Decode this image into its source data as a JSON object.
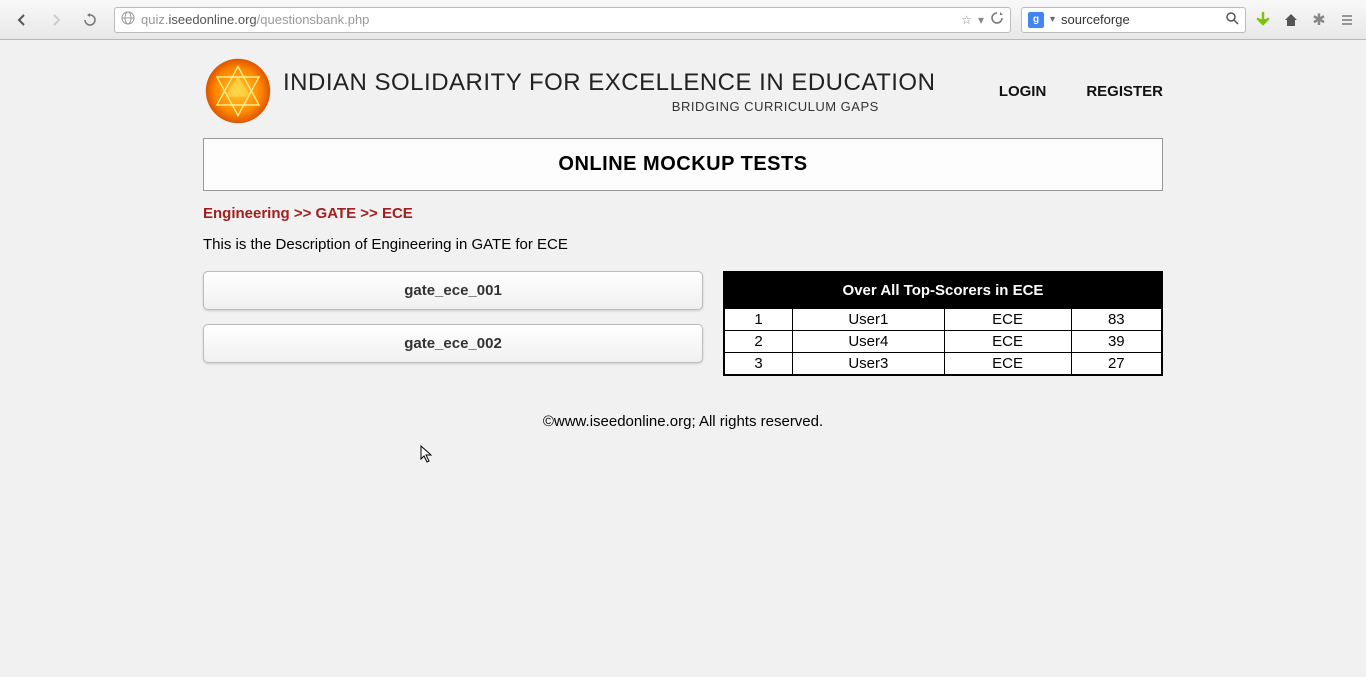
{
  "browser": {
    "url_prefix": "quiz.",
    "url_domain": "iseedonline.org",
    "url_path": "/questionsbank.php",
    "search_value": "sourceforge"
  },
  "header": {
    "title": "INDIAN SOLIDARITY FOR EXCELLENCE IN EDUCATION",
    "subtitle": "BRIDGING CURRICULUM GAPS",
    "login": "LOGIN",
    "register": "REGISTER"
  },
  "banner": "ONLINE MOCKUP TESTS",
  "breadcrumb": "Engineering >> GATE >> ECE",
  "description": "This is the Description of Engineering in GATE for ECE",
  "tests": [
    "gate_ece_001",
    "gate_ece_002"
  ],
  "scores": {
    "title": "Over All Top-Scorers in ECE",
    "rows": [
      {
        "rank": "1",
        "user": "User1",
        "cat": "ECE",
        "score": "83"
      },
      {
        "rank": "2",
        "user": "User4",
        "cat": "ECE",
        "score": "39"
      },
      {
        "rank": "3",
        "user": "User3",
        "cat": "ECE",
        "score": "27"
      }
    ]
  },
  "footer": "©www.iseedonline.org; All rights reserved."
}
